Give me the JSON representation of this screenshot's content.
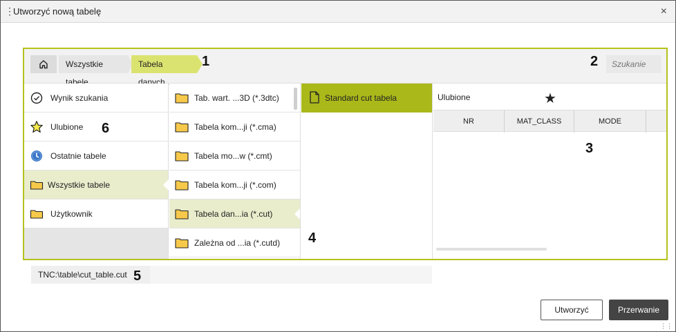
{
  "dialog": {
    "title": "Utworzyć nową tabelę",
    "close_icon": "close-icon",
    "menu_icon": "vertical-dots-icon"
  },
  "breadcrumb": {
    "home_icon": "home-icon",
    "items": [
      "Wszystkie tabele",
      "Tabela danych..."
    ],
    "active_color": "#dbe370"
  },
  "search": {
    "placeholder": "Szukanie"
  },
  "sidebar": {
    "items": [
      {
        "label": "Wynik szukania",
        "icon": "check-circle-icon"
      },
      {
        "label": "Ulubione",
        "icon": "star-outline-icon"
      },
      {
        "label": "Ostatnie tabele",
        "icon": "clock-icon"
      },
      {
        "label": "Wszystkie tabele",
        "icon": "folder-icon",
        "selected": true
      },
      {
        "label": "Użytkownik",
        "icon": "folder-icon"
      }
    ]
  },
  "table_types": {
    "items": [
      {
        "label": "Tab. wart. ...3D (*.3dtc)"
      },
      {
        "label": "Tabela kom...ji (*.cma)"
      },
      {
        "label": "Tabela mo...w (*.cmt)"
      },
      {
        "label": "Tabela kom...ji (*.com)"
      },
      {
        "label": "Tabela dan...ia (*.cut)",
        "selected": true
      },
      {
        "label": "Zależna od ...ia (*.cutd)"
      }
    ]
  },
  "templates": {
    "items": [
      {
        "label": "Standard cut tabela",
        "selected": true
      }
    ],
    "accent_color": "#aab81a"
  },
  "preview": {
    "favorites_label": "Ulubione",
    "star_icon": "star-filled-icon",
    "columns": [
      "NR",
      "MAT_CLASS",
      "MODE"
    ]
  },
  "path": {
    "value": "TNC:\\table\\cut_table.cut"
  },
  "buttons": {
    "create": "Utworzyć",
    "cancel": "Przerwanie"
  },
  "callouts": [
    "1",
    "2",
    "3",
    "4",
    "5",
    "6"
  ],
  "colors": {
    "frame_border": "#b4c21b",
    "selection_bg": "#e9edcc",
    "folder_fill": "#f7c94b"
  }
}
